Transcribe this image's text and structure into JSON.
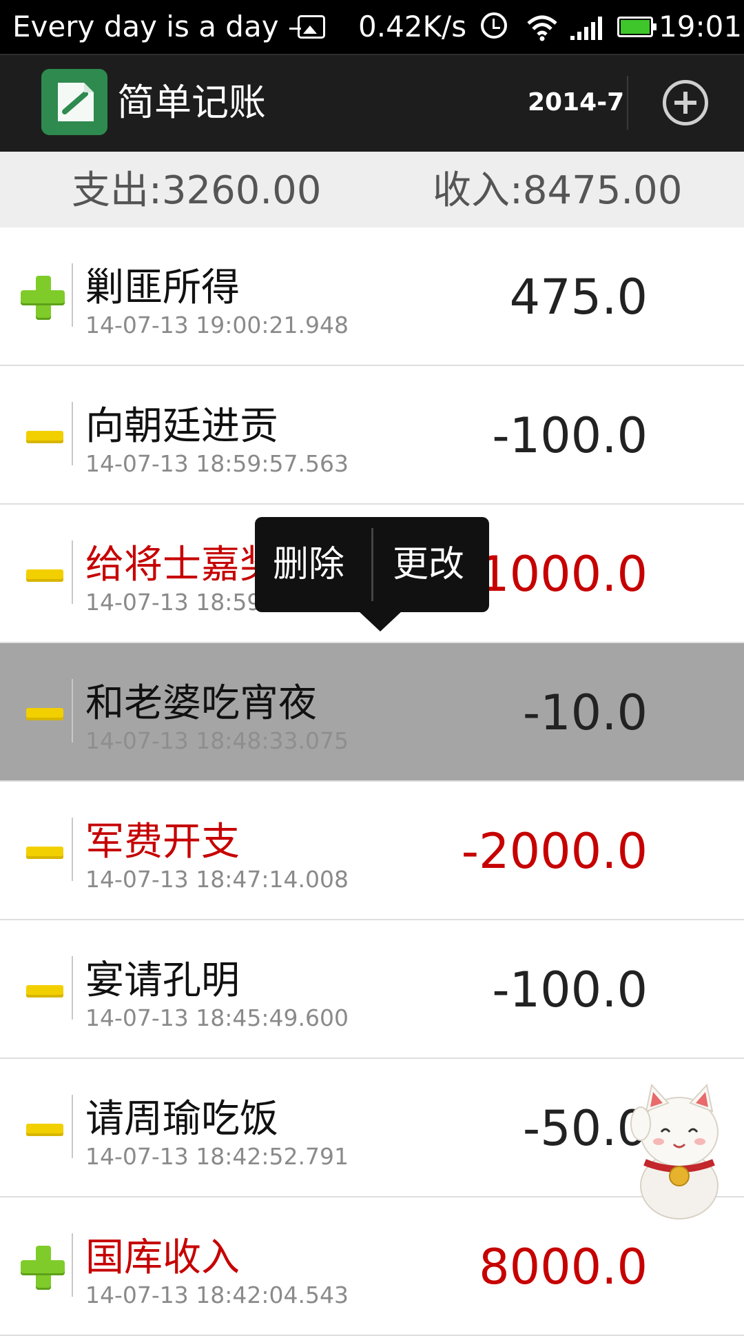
{
  "status_bar": {
    "notification": "Every day is a day –",
    "network_speed": "0.42K/s",
    "time": "19:01"
  },
  "action_bar": {
    "title": "简单记账",
    "month": "2014-7"
  },
  "summary": {
    "expense": "支出:3260.00",
    "income": "收入:8475.00"
  },
  "records": [
    {
      "type": "income",
      "title": "剿匪所得",
      "time": "14-07-13  19:00:21.948",
      "amount": "475.0",
      "highlight": false,
      "selected": false
    },
    {
      "type": "expense",
      "title": "向朝廷进贡",
      "time": "14-07-13  18:59:57.563",
      "amount": "-100.0",
      "highlight": false,
      "selected": false
    },
    {
      "type": "expense",
      "title": "给将士嘉奖",
      "time": "14-07-13  18:59",
      "amount": "-1000.0",
      "highlight": true,
      "selected": false
    },
    {
      "type": "expense",
      "title": "和老婆吃宵夜",
      "time": "14-07-13  18:48:33.075",
      "amount": "-10.0",
      "highlight": false,
      "selected": true
    },
    {
      "type": "expense",
      "title": "军费开支",
      "time": "14-07-13  18:47:14.008",
      "amount": "-2000.0",
      "highlight": true,
      "selected": false
    },
    {
      "type": "expense",
      "title": "宴请孔明",
      "time": "14-07-13  18:45:49.600",
      "amount": "-100.0",
      "highlight": false,
      "selected": false
    },
    {
      "type": "expense",
      "title": "请周瑜吃饭",
      "time": "14-07-13  18:42:52.791",
      "amount": "-50.0",
      "highlight": false,
      "selected": false
    },
    {
      "type": "income",
      "title": "国库收入",
      "time": "14-07-13  18:42:04.543",
      "amount": "8000.0",
      "highlight": true,
      "selected": false
    }
  ],
  "context_menu": {
    "delete_label": "删除",
    "edit_label": "更改"
  },
  "colors": {
    "highlight_red": "#c60000",
    "selected_row": "#a5a5a5",
    "logo_green": "#2e8a4e"
  }
}
